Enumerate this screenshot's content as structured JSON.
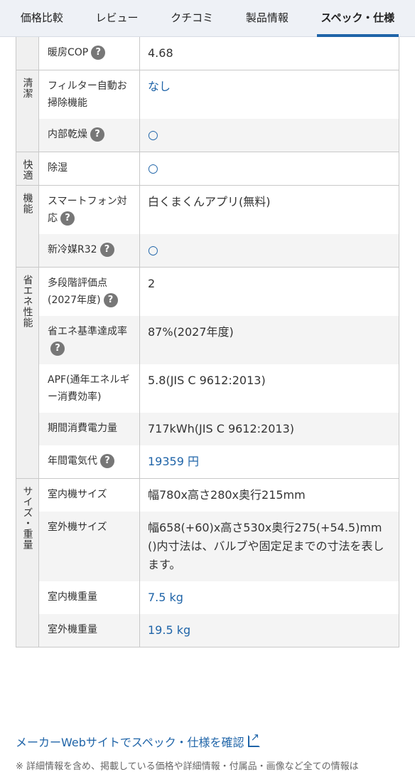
{
  "tabs": [
    "価格比較",
    "レビュー",
    "クチコミ",
    "製品情報",
    "スペック・仕様"
  ],
  "groups": [
    {
      "name": "",
      "rows": [
        {
          "label": "暖房COP",
          "help": true,
          "value": "4.68",
          "style": "plain"
        }
      ]
    },
    {
      "name": "清潔",
      "rows": [
        {
          "label": "フィルター自動お掃除機能",
          "help": false,
          "value": "なし",
          "style": "blue"
        },
        {
          "label": "内部乾燥",
          "help": true,
          "value": "○",
          "style": "circle"
        }
      ]
    },
    {
      "name": "快適",
      "rows": [
        {
          "label": "除湿",
          "help": false,
          "value": "○",
          "style": "circle"
        }
      ]
    },
    {
      "name": "機能",
      "rows": [
        {
          "label": "スマートフォン対応",
          "help": true,
          "value": "白くまくんアプリ(無料)",
          "style": "plain"
        },
        {
          "label": "新冷媒R32",
          "help": true,
          "value": "○",
          "style": "circle"
        }
      ]
    },
    {
      "name": "省エネ性能",
      "rows": [
        {
          "label": "多段階評価点(2027年度)",
          "help": true,
          "value": "2",
          "style": "plain"
        },
        {
          "label": "省エネ基準達成率",
          "help": true,
          "value": "87%(2027年度)",
          "style": "plain"
        },
        {
          "label": "APF(通年エネルギー消費効率)",
          "help": false,
          "value": "5.8(JIS C 9612:2013)",
          "style": "plain"
        },
        {
          "label": "期間消費電力量",
          "help": false,
          "value": "717kWh(JIS C 9612:2013)",
          "style": "plain"
        },
        {
          "label": "年間電気代",
          "help": true,
          "value": "19359 円",
          "style": "blue"
        }
      ]
    },
    {
      "name": "サイズ・重量",
      "rows": [
        {
          "label": "室内機サイズ",
          "help": false,
          "value": "幅780x高さ280x奥行215mm",
          "style": "plain"
        },
        {
          "label": "室外機サイズ",
          "help": false,
          "value": "幅658(+60)x高さ530x奥行275(+54.5)mm ()内寸法は、バルブや固定足までの寸法を表します。",
          "style": "plain"
        },
        {
          "label": "室内機重量",
          "help": false,
          "value": "7.5 kg",
          "style": "blue"
        },
        {
          "label": "室外機重量",
          "help": false,
          "value": "19.5 kg",
          "style": "blue"
        }
      ]
    }
  ],
  "help_mark": "?",
  "footer_link": "メーカーWebサイトでスペック・仕様を確認",
  "note": "※ 詳細情報を含め、掲載している価格や詳細情報・付属品・画像など全ての情報は"
}
